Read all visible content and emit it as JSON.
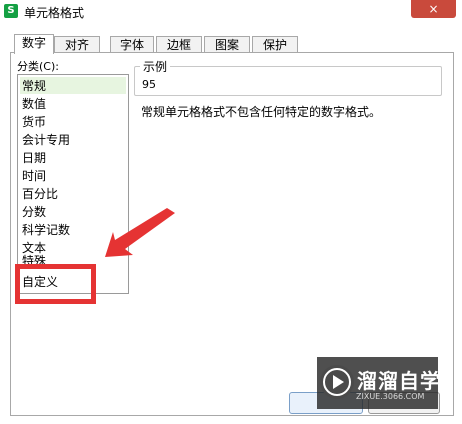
{
  "window": {
    "app_icon_letter": "S",
    "title": "单元格格式",
    "close_glyph": "×"
  },
  "tabs": [
    {
      "label": "数字",
      "active": true
    },
    {
      "label": "对齐",
      "active": false
    },
    {
      "label": "字体",
      "active": false
    },
    {
      "label": "边框",
      "active": false
    },
    {
      "label": "图案",
      "active": false
    },
    {
      "label": "保护",
      "active": false
    }
  ],
  "category": {
    "label": "分类(C):",
    "selected": "常规",
    "items": [
      "常规",
      "数值",
      "货币",
      "会计专用",
      "日期",
      "时间",
      "百分比",
      "分数",
      "科学记数",
      "文本",
      "特殊",
      "自定义"
    ]
  },
  "sample": {
    "legend": "示例",
    "value": "95"
  },
  "description": "常规单元格格式不包含任何特定的数字格式。",
  "annotation": {
    "arrow_color": "#e53333",
    "highlight_color": "#e53333"
  },
  "watermark": {
    "brand": "溜溜自学",
    "domain": "ZIXUE.3066.COM"
  }
}
